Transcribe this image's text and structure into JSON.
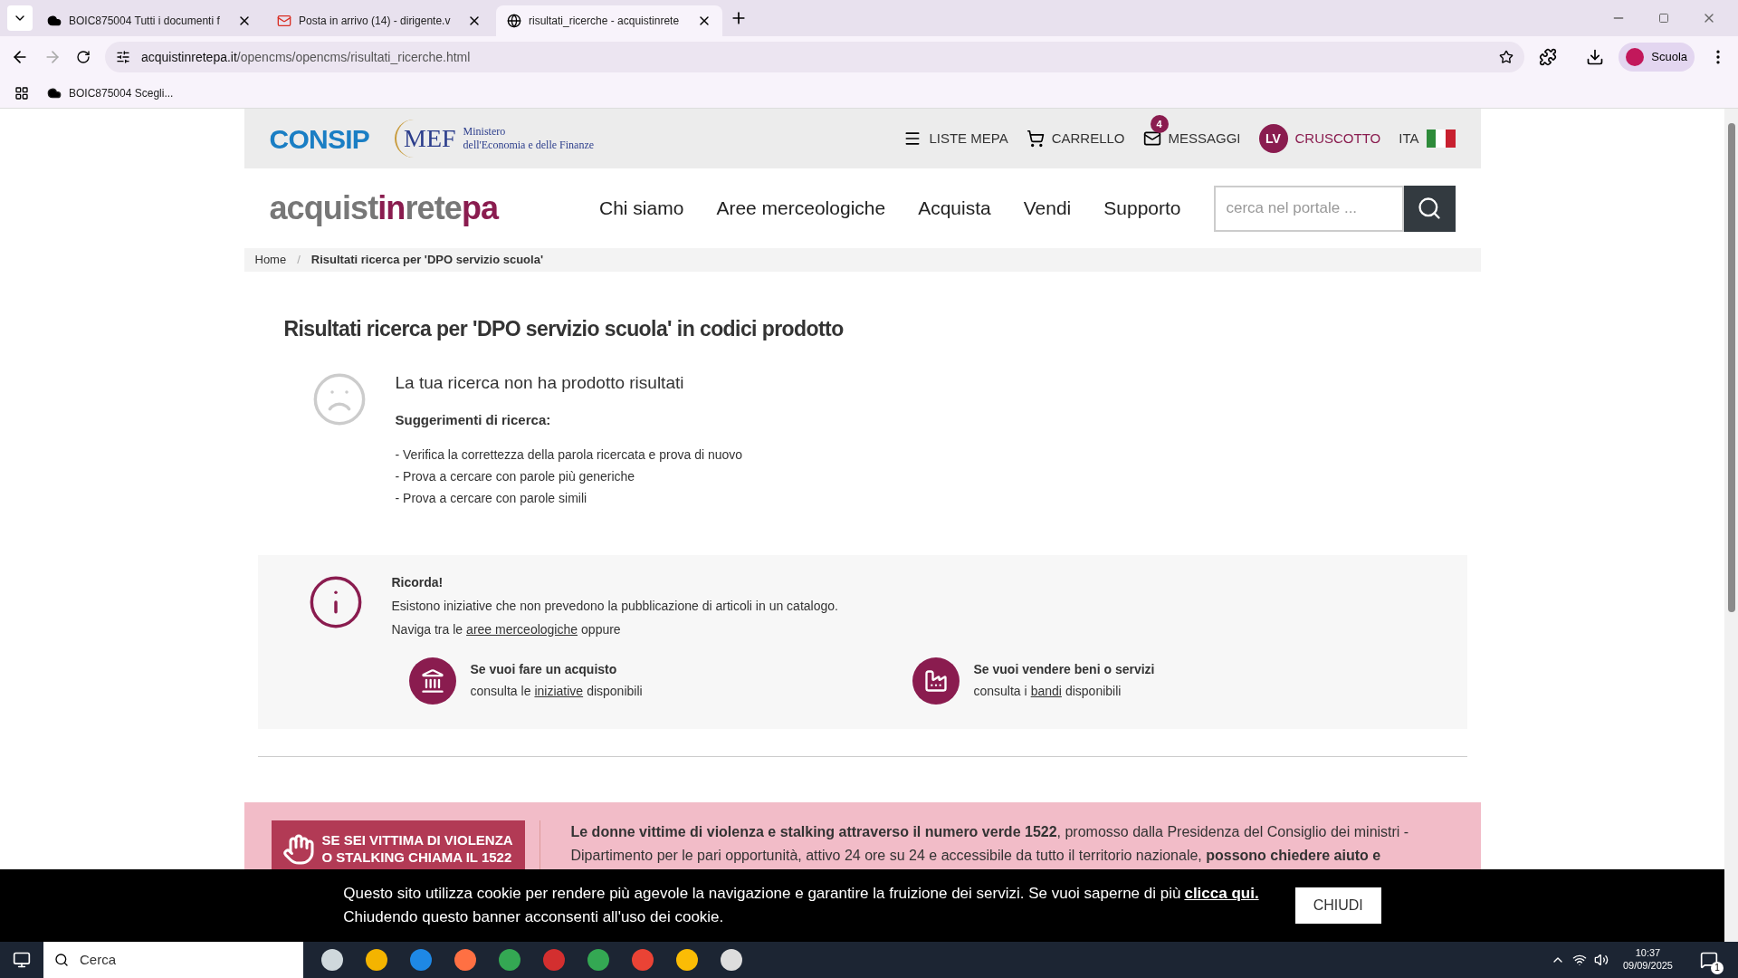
{
  "browser": {
    "tabs": [
      {
        "title": "BOIC875004 Tutti i documenti f",
        "selected": false
      },
      {
        "title": "Posta in arrivo (14) - dirigente.v",
        "selected": false
      },
      {
        "title": "risultati_ricerche - acquistinrete",
        "selected": true
      }
    ],
    "url_host": "acquistinretepa.it",
    "url_path": "/opencms/opencms/risultati_ricerche.html",
    "profile": "Scuola",
    "bookmarks": [
      "BOIC875004 Scegli..."
    ]
  },
  "top_bar": {
    "consip": "CONSIP",
    "mef": "MEF",
    "ministry_lines": [
      "Ministero",
      "dell'Economia e delle Finanze"
    ],
    "links": [
      {
        "kind": "menu",
        "label": "LISTE MEPA"
      },
      {
        "kind": "cart",
        "label": "CARRELLO"
      },
      {
        "kind": "mail",
        "label": "MESSAGGI",
        "badge": "4"
      },
      {
        "kind": "user",
        "label": "CRUSCOTTO",
        "initials": "LV"
      },
      {
        "kind": "lang",
        "label": "ITA"
      }
    ]
  },
  "logo_parts": [
    {
      "text": "acquist",
      "highlight": false
    },
    {
      "text": "in",
      "highlight": true
    },
    {
      "text": "rete",
      "highlight": false
    },
    {
      "text": "pa",
      "highlight": true
    }
  ],
  "nav": [
    "Chi siamo",
    "Aree merceologiche",
    "Acquista",
    "Vendi",
    "Supporto"
  ],
  "search": {
    "placeholder": "cerca nel portale ..."
  },
  "breadcrumb": [
    "Home",
    "/",
    "Risultati ricerca per 'DPO servizio scuola'"
  ],
  "heading": "Risultati ricerca per 'DPO servizio scuola' in codici prodotto",
  "no_results": {
    "title": "La tua ricerca non ha prodotto risultati",
    "subtitle": "Suggerimenti di ricerca:",
    "tips": [
      "- Verifica la correttezza della parola ricercata e prova di nuovo",
      "- Prova a cercare con parole più generiche",
      "- Prova a cercare con parole simili"
    ]
  },
  "remember": {
    "title": "Ricorda!",
    "line1": "Esistono iniziative che non prevedono la pubblicazione di articoli in un catalogo.",
    "line2_before": "Naviga tra le",
    "line2_link": "aree merceologiche",
    "line2_after": "oppure",
    "cards": [
      {
        "kind": "buy",
        "title": "Se vuoi fare un acquisto",
        "before": "consulta le",
        "link": "iniziative",
        "after": "disponibili"
      },
      {
        "kind": "sell",
        "title": "Se vuoi vendere beni o servizi",
        "before": "consulta i",
        "link": "bandi",
        "after": "disponibili"
      }
    ]
  },
  "violence_banner": {
    "image_lines": [
      "SE SEI VITTIMA DI VIOLENZA",
      "O STALKING CHIAMA IL 1522"
    ],
    "text": "**Le donne vittime di violenza e stalking attraverso il numero verde 1522**, promosso dalla Presidenza del Consiglio dei ministri - Dipartimento per le pari opportunità, attivo 24 ore su 24 e accessibile da tutto il territorio nazionale, **possono chiedere aiuto e**"
  },
  "cookie": {
    "text": "Questo sito utilizza cookie per rendere più agevole la navigazione e garantire la fruizione dei servizi. Se vuoi saperne di più",
    "link": "clicca qui.",
    "line2": "Chiudendo questo banner acconsenti all'uso dei cookie.",
    "button": "CHIUDI"
  },
  "taskbar": {
    "search": "Cerca",
    "time": "10:37",
    "date": "09/09/2025",
    "notifications": "1"
  }
}
